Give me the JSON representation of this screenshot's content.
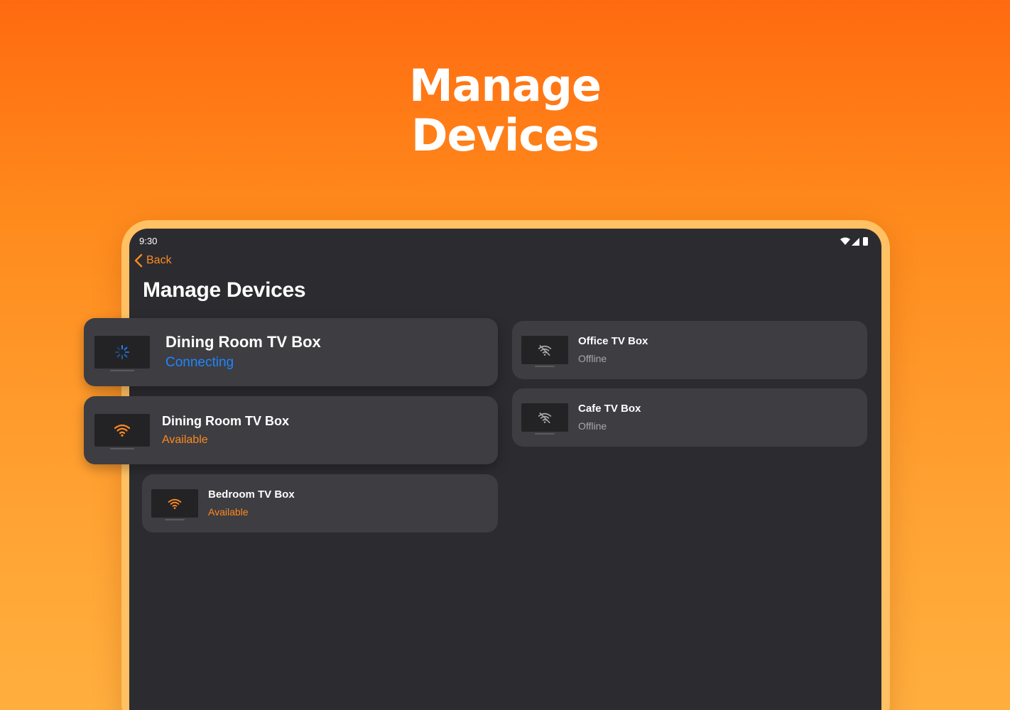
{
  "hero": {
    "line1": "Manage",
    "line2": "Devices"
  },
  "status_bar": {
    "time": "9:30",
    "icons": [
      "wifi-icon",
      "cell-signal-icon",
      "battery-icon"
    ]
  },
  "nav": {
    "back_label": "Back"
  },
  "page": {
    "title": "Manage Devices"
  },
  "devices": [
    {
      "name": "Dining Room TV Box",
      "status": "Connecting",
      "icon": "loading-spinner-icon"
    },
    {
      "name": "Dining Room TV Box",
      "status": "Available",
      "icon": "wifi-icon"
    },
    {
      "name": "Bedroom TV Box",
      "status": "Available",
      "icon": "wifi-icon"
    },
    {
      "name": "Office TV Box",
      "status": "Offline",
      "icon": "wifi-off-icon"
    },
    {
      "name": "Cafe TV Box",
      "status": "Offline",
      "icon": "wifi-off-icon"
    }
  ],
  "colors": {
    "accent": "#ff8a1e",
    "connecting": "#1f86ff",
    "offline": "#a7a7ad",
    "screen_background": "#2c2c30",
    "card_background": "#3d3d42"
  }
}
